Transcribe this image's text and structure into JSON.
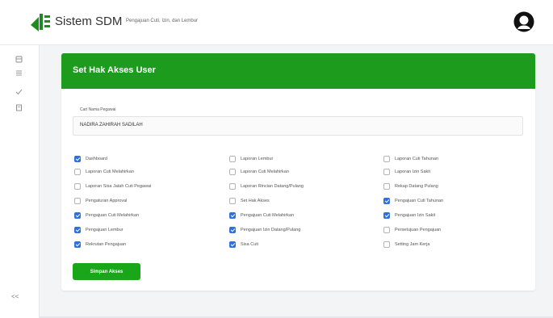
{
  "app": {
    "title": "Sistem SDM",
    "subtitle": "Pengajuan Cuti, Izin, dan Lembur",
    "colors": {
      "primary_green": "#1c9b1c",
      "button_green": "#19a619",
      "checkbox_blue": "#2f6fe0"
    }
  },
  "sidebar": {
    "icons": [
      "dashboard-icon",
      "list-icon",
      "check-icon",
      "document-icon"
    ],
    "collapse_label": "<<"
  },
  "card": {
    "title": "Set Hak Akses User",
    "employee_label": "Cari Nama Pegawai",
    "employee_value": "NADIRA ZAHIRAH SADILAH",
    "save_label": "Simpan Akses"
  },
  "permissions": [
    [
      {
        "label": "Dashboard",
        "checked": true
      },
      {
        "label": "Laporan Cuti Melahirkan",
        "checked": false
      },
      {
        "label": "Laporan Sisa Jatah Cuti Pegawai",
        "checked": false
      },
      {
        "label": "Pengaturan Approval",
        "checked": false
      },
      {
        "label": "Pengajuan Cuti Melahirkan",
        "checked": true
      },
      {
        "label": "Pengajuan Lembur",
        "checked": true
      },
      {
        "label": "Rekrutan Pengajuan",
        "checked": true
      }
    ],
    [
      {
        "label": "Laporan Lembur",
        "checked": false
      },
      {
        "label": "Laporan Cuti Melahirkan",
        "checked": false
      },
      {
        "label": "Laporan Rincian Datang/Pulang",
        "checked": false
      },
      {
        "label": "Set Hak Akses",
        "checked": false
      },
      {
        "label": "Pengajuan Cuti Melahirkan",
        "checked": true
      },
      {
        "label": "Pengajuan Izin Datang/Pulang",
        "checked": true
      },
      {
        "label": "Sisa Cuti",
        "checked": true
      }
    ],
    [
      {
        "label": "Laporan Cuti Tahunan",
        "checked": false
      },
      {
        "label": "Laporan Izin Sakit",
        "checked": false
      },
      {
        "label": "Rekap Datang Pulang",
        "checked": false
      },
      {
        "label": "Pengajuan Cuti Tahunan",
        "checked": true
      },
      {
        "label": "Pengajuan Izin Sakit",
        "checked": true
      },
      {
        "label": "Persetujuan Pengajuan",
        "checked": false
      },
      {
        "label": "Setting Jam Kerja",
        "checked": false
      }
    ]
  ]
}
